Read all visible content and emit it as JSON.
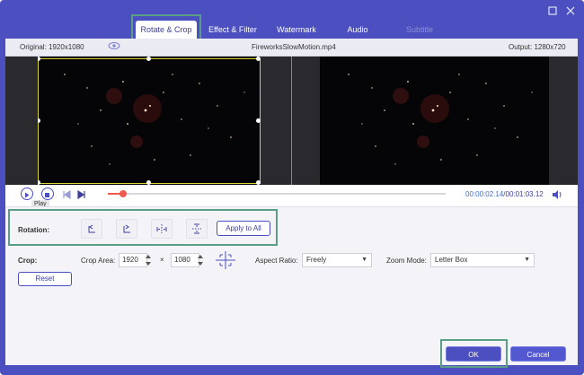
{
  "window": {
    "minimize_icon": "minimize-icon",
    "maximize_icon": "maximize-icon",
    "close_icon": "close-icon"
  },
  "tabs": [
    {
      "label": "Rotate & Crop",
      "state": "active"
    },
    {
      "label": "Effect & Filter",
      "state": "normal"
    },
    {
      "label": "Watermark",
      "state": "normal"
    },
    {
      "label": "Audio",
      "state": "normal"
    },
    {
      "label": "Subtitle",
      "state": "disabled"
    }
  ],
  "infobar": {
    "original": "Original: 1920x1080",
    "filename": "FireworksSlowMotion.mp4",
    "output": "Output: 1280x720"
  },
  "player": {
    "tooltip": "Play",
    "current_time": "00:00:02.14",
    "total_time": "/00:01:03.12",
    "progress": 0.045
  },
  "rotation": {
    "label": "Rotation:",
    "buttons": [
      "rotate-left",
      "rotate-right",
      "flip-horizontal",
      "flip-vertical"
    ],
    "apply_all": "Apply to All"
  },
  "crop": {
    "label": "Crop:",
    "area_label": "Crop Area:",
    "width": "1920",
    "times": "×",
    "height": "1080",
    "aspect_label": "Aspect Ratio:",
    "aspect_value": "Freely",
    "zoom_label": "Zoom Mode:",
    "zoom_value": "Letter Box",
    "reset": "Reset"
  },
  "footer": {
    "ok": "OK",
    "cancel": "Cancel"
  },
  "colors": {
    "accent": "#4b4fbf",
    "highlight": "#5b9e86",
    "progress": "#ef5a4d",
    "crop_frame": "#d8d434"
  }
}
